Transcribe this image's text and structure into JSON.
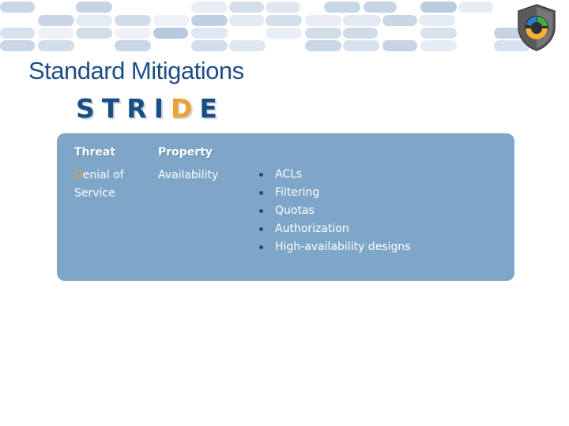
{
  "slide": {
    "title": "Standard Mitigations",
    "acronym": {
      "letters": [
        "S",
        "T",
        "R",
        "I",
        "D",
        "E"
      ],
      "highlighted_letter": "D",
      "highlight_color": "#f0a030",
      "base_color": "#1a4c85"
    },
    "table": {
      "headers": {
        "threat": "Threat",
        "property": "Property"
      },
      "row": {
        "threat_initial": "D",
        "threat_rest_line1": "enial of",
        "threat_line2": "Service",
        "property": "Availability",
        "mitigations": [
          "ACLs",
          "Filtering",
          "Quotas",
          "Authorization",
          "High-availability designs"
        ]
      }
    },
    "colors": {
      "panel": "#7ea6c8",
      "title": "#1f4e85"
    },
    "icons": {
      "logo": "shield-logo-icon"
    }
  }
}
